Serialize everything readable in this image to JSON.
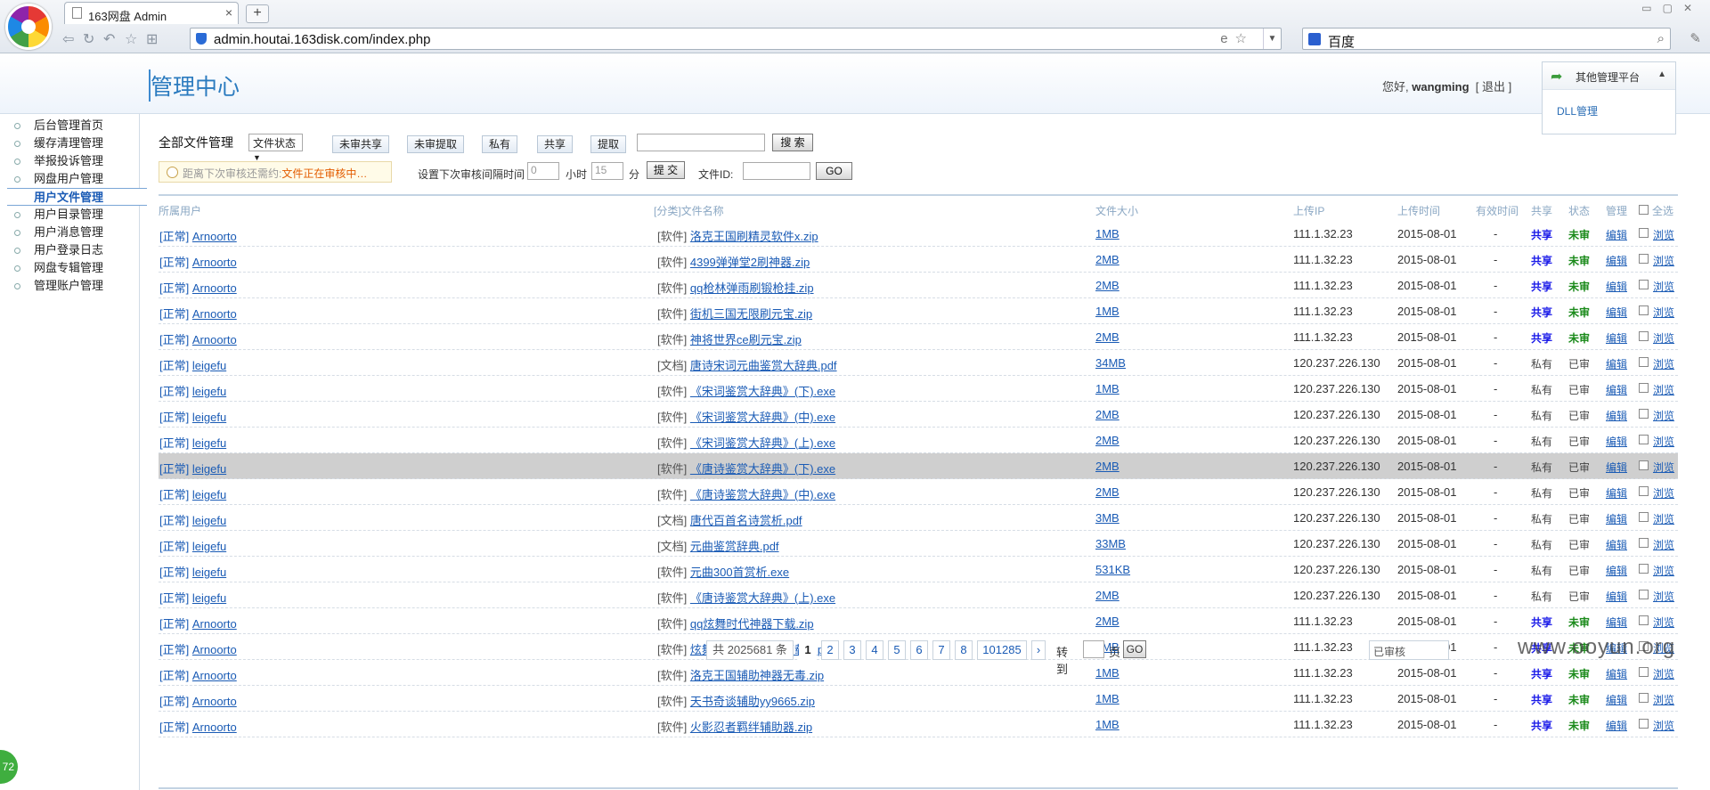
{
  "browser": {
    "tab_title": "163网盘 Admin",
    "tab_close": "×",
    "new_tab": "+",
    "url": "admin.houtai.163disk.com/index.php",
    "search_engine": "百度"
  },
  "header": {
    "title": "管理中心",
    "greeting_prefix": "您好,",
    "username": "wangming",
    "logout": "[ 退出 ]",
    "platform_label": "其他管理平台",
    "platform_item": "DLL管理"
  },
  "sidebar": {
    "items": [
      {
        "label": "后台管理首页"
      },
      {
        "label": "缓存清理管理"
      },
      {
        "label": "举报投诉管理"
      },
      {
        "label": "网盘用户管理"
      },
      {
        "label": "用户文件管理"
      },
      {
        "label": "用户目录管理"
      },
      {
        "label": "用户消息管理"
      },
      {
        "label": "用户登录日志"
      },
      {
        "label": "网盘专辑管理"
      },
      {
        "label": "管理账户管理"
      }
    ],
    "active_index": 4
  },
  "toolbar": {
    "title": "全部文件管理",
    "status_select": "文件状态",
    "btn_unreviewed_share": "未审共享",
    "btn_unreviewed_extract": "未审提取",
    "btn_private": "私有",
    "btn_share": "共享",
    "btn_extract": "提取",
    "search_btn": "搜 索",
    "notice_prefix": "距离下次审核还需约:",
    "notice_status": "文件正在审核中…",
    "interval_label": "设置下次审核间隔时间",
    "hours_value": "0",
    "hours_label": "小时",
    "minutes_value": "15",
    "minutes_label": "分",
    "submit_btn": "提 交",
    "file_id_label": "文件ID:",
    "go_btn": "GO"
  },
  "table": {
    "headers": {
      "user": "所属用户",
      "file": "[分类]文件名称",
      "size": "文件大小",
      "ip": "上传IP",
      "time": "上传时间",
      "valid": "有效时间",
      "share": "共享",
      "status": "状态",
      "manage": "管理",
      "select_all": "全选"
    },
    "rows": [
      {
        "status_tag": "[正常]",
        "user": "Arnoorto",
        "category": "[软件]",
        "file": "洛克王国刷精灵软件x.zip",
        "size": "1MB",
        "ip": "111.1.32.23",
        "time": "2015-08-01",
        "valid": "-",
        "share": "共享",
        "review": "未审",
        "edit": "编辑",
        "view": "浏览"
      },
      {
        "status_tag": "[正常]",
        "user": "Arnoorto",
        "category": "[软件]",
        "file": "4399弹弹堂2刷神器.zip",
        "size": "2MB",
        "ip": "111.1.32.23",
        "time": "2015-08-01",
        "valid": "-",
        "share": "共享",
        "review": "未审",
        "edit": "编辑",
        "view": "浏览"
      },
      {
        "status_tag": "[正常]",
        "user": "Arnoorto",
        "category": "[软件]",
        "file": "qq枪林弹雨刷锻枪挂.zip",
        "size": "2MB",
        "ip": "111.1.32.23",
        "time": "2015-08-01",
        "valid": "-",
        "share": "共享",
        "review": "未审",
        "edit": "编辑",
        "view": "浏览"
      },
      {
        "status_tag": "[正常]",
        "user": "Arnoorto",
        "category": "[软件]",
        "file": "街机三国无限刷元宝.zip",
        "size": "1MB",
        "ip": "111.1.32.23",
        "time": "2015-08-01",
        "valid": "-",
        "share": "共享",
        "review": "未审",
        "edit": "编辑",
        "view": "浏览"
      },
      {
        "status_tag": "[正常]",
        "user": "Arnoorto",
        "category": "[软件]",
        "file": "神将世界ce刷元宝.zip",
        "size": "2MB",
        "ip": "111.1.32.23",
        "time": "2015-08-01",
        "valid": "-",
        "share": "共享",
        "review": "未审",
        "edit": "编辑",
        "view": "浏览"
      },
      {
        "status_tag": "[正常]",
        "user": "leigefu",
        "category": "[文档]",
        "file": "唐诗宋词元曲鉴赏大辞典.pdf",
        "size": "34MB",
        "ip": "120.237.226.130",
        "time": "2015-08-01",
        "valid": "-",
        "share": "私有",
        "review": "已审",
        "edit": "编辑",
        "view": "浏览"
      },
      {
        "status_tag": "[正常]",
        "user": "leigefu",
        "category": "[软件]",
        "file": "《宋词鉴赏大辞典》(下).exe",
        "size": "1MB",
        "ip": "120.237.226.130",
        "time": "2015-08-01",
        "valid": "-",
        "share": "私有",
        "review": "已审",
        "edit": "编辑",
        "view": "浏览"
      },
      {
        "status_tag": "[正常]",
        "user": "leigefu",
        "category": "[软件]",
        "file": "《宋词鉴赏大辞典》(中).exe",
        "size": "2MB",
        "ip": "120.237.226.130",
        "time": "2015-08-01",
        "valid": "-",
        "share": "私有",
        "review": "已审",
        "edit": "编辑",
        "view": "浏览"
      },
      {
        "status_tag": "[正常]",
        "user": "leigefu",
        "category": "[软件]",
        "file": "《宋词鉴赏大辞典》(上).exe",
        "size": "2MB",
        "ip": "120.237.226.130",
        "time": "2015-08-01",
        "valid": "-",
        "share": "私有",
        "review": "已审",
        "edit": "编辑",
        "view": "浏览"
      },
      {
        "status_tag": "[正常]",
        "user": "leigefu",
        "category": "[软件]",
        "file": "《唐诗鉴赏大辞典》(下).exe",
        "size": "2MB",
        "ip": "120.237.226.130",
        "time": "2015-08-01",
        "valid": "-",
        "share": "私有",
        "review": "已审",
        "edit": "编辑",
        "view": "浏览"
      },
      {
        "status_tag": "[正常]",
        "user": "leigefu",
        "category": "[软件]",
        "file": "《唐诗鉴赏大辞典》(中).exe",
        "size": "2MB",
        "ip": "120.237.226.130",
        "time": "2015-08-01",
        "valid": "-",
        "share": "私有",
        "review": "已审",
        "edit": "编辑",
        "view": "浏览"
      },
      {
        "status_tag": "[正常]",
        "user": "leigefu",
        "category": "[文档]",
        "file": "唐代百首名诗赏析.pdf",
        "size": "3MB",
        "ip": "120.237.226.130",
        "time": "2015-08-01",
        "valid": "-",
        "share": "私有",
        "review": "已审",
        "edit": "编辑",
        "view": "浏览"
      },
      {
        "status_tag": "[正常]",
        "user": "leigefu",
        "category": "[文档]",
        "file": "元曲鉴赏辞典.pdf",
        "size": "33MB",
        "ip": "120.237.226.130",
        "time": "2015-08-01",
        "valid": "-",
        "share": "私有",
        "review": "已审",
        "edit": "编辑",
        "view": "浏览"
      },
      {
        "status_tag": "[正常]",
        "user": "leigefu",
        "category": "[软件]",
        "file": "元曲300首赏析.exe",
        "size": "531KB",
        "ip": "120.237.226.130",
        "time": "2015-08-01",
        "valid": "-",
        "share": "私有",
        "review": "已审",
        "edit": "编辑",
        "view": "浏览"
      },
      {
        "status_tag": "[正常]",
        "user": "leigefu",
        "category": "[软件]",
        "file": "《唐诗鉴赏大辞典》(上).exe",
        "size": "2MB",
        "ip": "120.237.226.130",
        "time": "2015-08-01",
        "valid": "-",
        "share": "私有",
        "review": "已审",
        "edit": "编辑",
        "view": "浏览"
      },
      {
        "status_tag": "[正常]",
        "user": "Arnoorto",
        "category": "[软件]",
        "file": "qq炫舞时代神器下载.zip",
        "size": "2MB",
        "ip": "111.1.32.23",
        "time": "2015-08-01",
        "valid": "-",
        "share": "共享",
        "review": "未审",
        "edit": "编辑",
        "view": "浏览"
      },
      {
        "status_tag": "[正常]",
        "user": "Arnoorto",
        "category": "[软件]",
        "file": "炫舞时代辅助神器下载.zip",
        "size": "2MB",
        "ip": "111.1.32.23",
        "time": "2015-08-01",
        "valid": "-",
        "share": "共享",
        "review": "未审",
        "edit": "编辑",
        "view": "浏览"
      },
      {
        "status_tag": "[正常]",
        "user": "Arnoorto",
        "category": "[软件]",
        "file": "洛克王国辅助神器无毒.zip",
        "size": "1MB",
        "ip": "111.1.32.23",
        "time": "2015-08-01",
        "valid": "-",
        "share": "共享",
        "review": "未审",
        "edit": "编辑",
        "view": "浏览"
      },
      {
        "status_tag": "[正常]",
        "user": "Arnoorto",
        "category": "[软件]",
        "file": "天书奇谈辅助yy9665.zip",
        "size": "1MB",
        "ip": "111.1.32.23",
        "time": "2015-08-01",
        "valid": "-",
        "share": "共享",
        "review": "未审",
        "edit": "编辑",
        "view": "浏览"
      },
      {
        "status_tag": "[正常]",
        "user": "Arnoorto",
        "category": "[软件]",
        "file": "火影忍者羁绊辅助器.zip",
        "size": "1MB",
        "ip": "111.1.32.23",
        "time": "2015-08-01",
        "valid": "-",
        "share": "共享",
        "review": "未审",
        "edit": "编辑",
        "view": "浏览"
      }
    ],
    "highlighted_row": 9
  },
  "pager": {
    "total": "共 2025681 条",
    "pages": [
      "1",
      "2",
      "3",
      "4",
      "5",
      "6",
      "7",
      "8",
      "101285"
    ],
    "current": "1",
    "next": "›",
    "jump_label": "转到",
    "page_label": "页",
    "go": "GO",
    "corner_select": "已审核"
  },
  "watermark": "www.ooyun.org",
  "float_ball": "72",
  "colors": {
    "accent": "#2b7bbf",
    "link": "#1a5bb5",
    "share_public": "#1a1ae8",
    "unreviewed": "#1a8a1a",
    "notice": "#e35c00"
  }
}
